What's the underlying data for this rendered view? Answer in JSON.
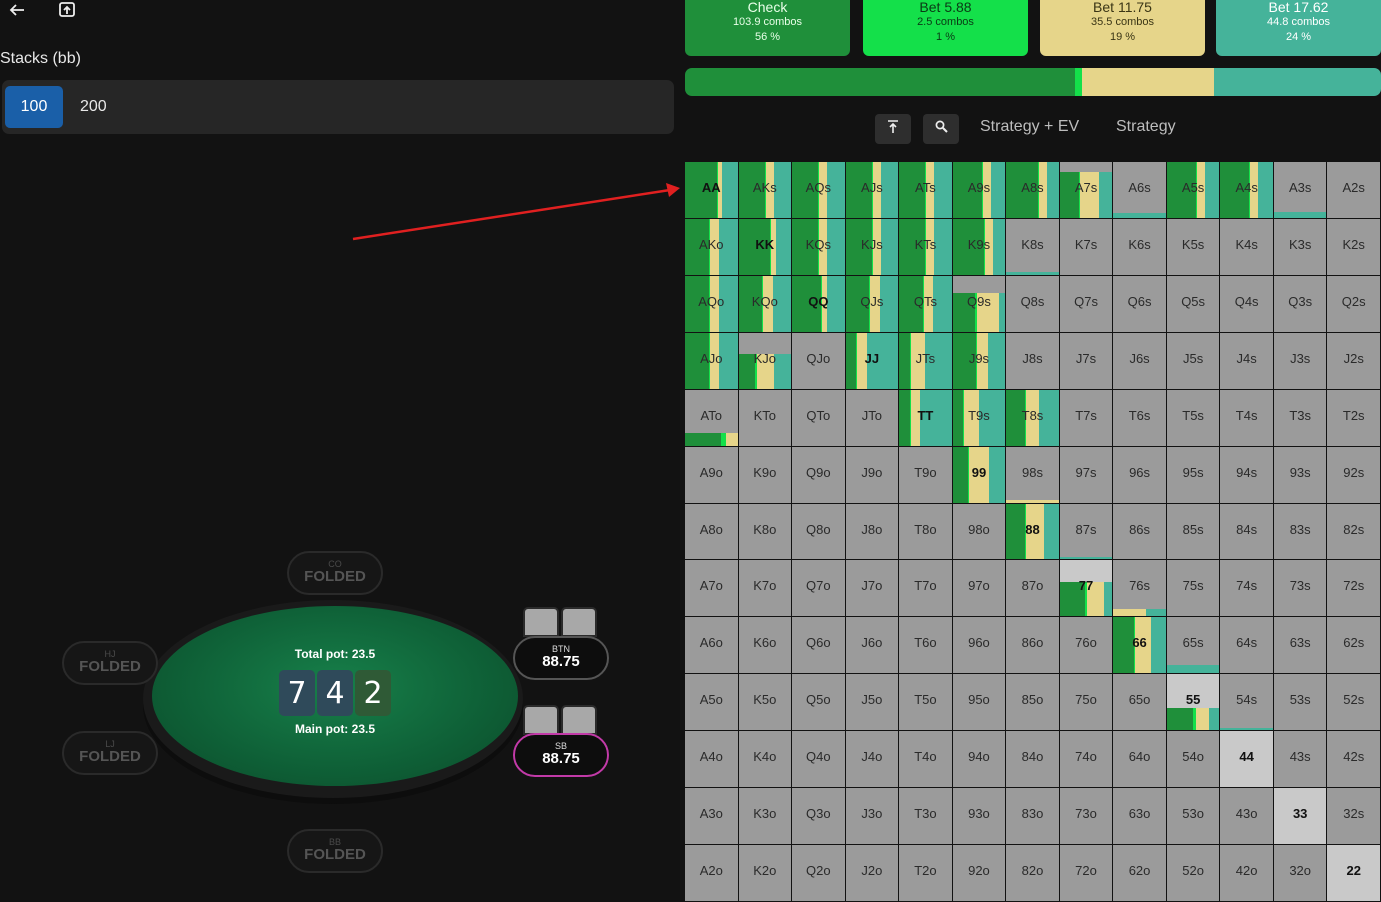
{
  "header": {
    "back_icon": "arrow-left-icon",
    "share_icon": "upload-icon"
  },
  "stacks": {
    "label": "Stacks (bb)",
    "options": [
      "100",
      "200"
    ],
    "selected": "100"
  },
  "table": {
    "total_pot": "Total pot: 23.5",
    "main_pot": "Main pot: 23.5",
    "board": [
      {
        "rank": "7",
        "color": "#2f4a5a"
      },
      {
        "rank": "4",
        "color": "#2f4a5a"
      },
      {
        "rank": "2",
        "color": "#2f5a36"
      }
    ],
    "seats": {
      "co": {
        "pos": "CO",
        "status": "FOLDED"
      },
      "hj": {
        "pos": "HJ",
        "status": "FOLDED"
      },
      "lj": {
        "pos": "LJ",
        "status": "FOLDED"
      },
      "bb": {
        "pos": "BB",
        "status": "FOLDED"
      },
      "btn": {
        "pos": "BTN",
        "stack": "88.75"
      },
      "sb": {
        "pos": "SB",
        "stack": "88.75"
      }
    }
  },
  "actions": [
    {
      "title": "Check",
      "combos": "103.9 combos",
      "pct": "56 %",
      "color": "#1f8f3a",
      "text": "#e8ffe8"
    },
    {
      "title": "Bet 5.88",
      "combos": "2.5 combos",
      "pct": "1 %",
      "color": "#14e04a",
      "text": "#0a3a15"
    },
    {
      "title": "Bet 11.75",
      "combos": "35.5 combos",
      "pct": "19 %",
      "color": "#e6d58a",
      "text": "#3a3515"
    },
    {
      "title": "Bet 17.62",
      "combos": "44.8 combos",
      "pct": "24 %",
      "color": "#45b39a",
      "text": "#ffffff"
    }
  ],
  "frequencies": [
    56,
    1,
    19,
    24
  ],
  "toolbar": {
    "filter_icon": "filter-icon",
    "search_icon": "magnifier-icon",
    "tab_strategy_ev": "Strategy + EV",
    "tab_strategy": "Strategy"
  },
  "grid": {
    "ranks": [
      "A",
      "K",
      "Q",
      "J",
      "T",
      "9",
      "8",
      "7",
      "6",
      "5",
      "4",
      "3",
      "2"
    ],
    "colors": {
      "check": "#1f8f3a",
      "bet_small": "#14e04a",
      "bet_mid": "#e6d58a",
      "bet_big": "#45b39a",
      "empty": "#9b9b9b",
      "pair_light": "#c9c9c9"
    },
    "strategies": {
      "AA": [
        60,
        2,
        8,
        30
      ],
      "AKs": [
        50,
        2,
        15,
        33
      ],
      "AQs": [
        50,
        2,
        15,
        33
      ],
      "AJs": [
        50,
        2,
        15,
        33
      ],
      "ATs": [
        50,
        2,
        15,
        33
      ],
      "A9s": [
        55,
        2,
        15,
        28
      ],
      "A8s": [
        60,
        2,
        15,
        23
      ],
      "A7s": [
        30,
        2,
        30,
        20
      ],
      "A6s": [
        0,
        0,
        0,
        8
      ],
      "A5s": [
        55,
        2,
        15,
        28
      ],
      "A4s": [
        55,
        2,
        15,
        28
      ],
      "A3s": [
        0,
        0,
        0,
        10
      ],
      "A2s": [
        0,
        0,
        0,
        0
      ],
      "AKo": [
        45,
        2,
        18,
        35
      ],
      "KK": [
        60,
        2,
        10,
        28
      ],
      "KQs": [
        50,
        2,
        15,
        33
      ],
      "KJs": [
        50,
        2,
        15,
        33
      ],
      "KTs": [
        50,
        2,
        15,
        33
      ],
      "K9s": [
        60,
        2,
        15,
        23
      ],
      "K8s": [
        0,
        0,
        0,
        6
      ],
      "AQo": [
        45,
        2,
        18,
        35
      ],
      "KQo": [
        45,
        2,
        18,
        35
      ],
      "QQ": [
        55,
        2,
        10,
        33
      ],
      "QJs": [
        45,
        2,
        18,
        35
      ],
      "QTs": [
        45,
        2,
        18,
        35
      ],
      "Q9s": [
        30,
        2,
        30,
        8
      ],
      "AJo": [
        45,
        2,
        18,
        35
      ],
      "KJo": [
        20,
        2,
        20,
        20
      ],
      "JJ": [
        20,
        2,
        18,
        60
      ],
      "JTs": [
        20,
        2,
        28,
        50
      ],
      "J9s": [
        45,
        2,
        20,
        33
      ],
      "ATo": [
        15,
        2,
        5,
        0
      ],
      "TT": [
        20,
        2,
        18,
        60
      ],
      "T9s": [
        20,
        2,
        28,
        50
      ],
      "T8s": [
        35,
        2,
        25,
        38
      ],
      "99": [
        30,
        2,
        38,
        30
      ],
      "98s": [
        0,
        0,
        5,
        0
      ],
      "88": [
        35,
        2,
        35,
        28
      ],
      "87s": [
        0,
        0,
        0,
        5
      ],
      "77": [
        30,
        2,
        20,
        10
      ],
      "76s": [
        0,
        0,
        8,
        5
      ],
      "66": [
        40,
        2,
        30,
        28
      ],
      "65s": [
        0,
        0,
        0,
        15
      ],
      "55": [
        20,
        2,
        10,
        8
      ],
      "54s": [
        0,
        0,
        0,
        4
      ]
    }
  }
}
